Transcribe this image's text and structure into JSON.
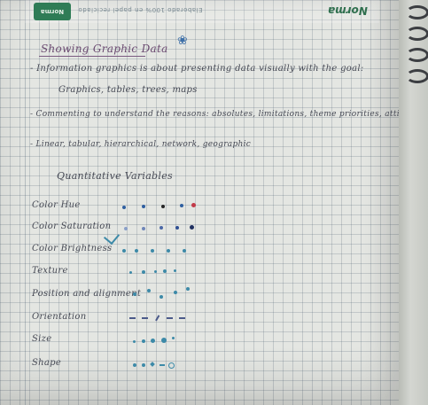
{
  "photo": {
    "subject": "spiral notebook page with handwritten notes",
    "paper": {
      "header": {
        "logo_text": "Norma",
        "printed_text": "Elaborado 100% en papel reciclado",
        "brand_text": "Norma"
      }
    },
    "notes": {
      "title": "Showing Graphic Data",
      "lines": [
        "- Information graphics is about presenting data visually with the goal:",
        "Graphics, tables, trees, maps",
        "- Commenting to understand the reasons: absolutes, limitations, theme priorities, attitudes",
        "- Linear, tabular, hierarchical, network, geographic"
      ],
      "variables_heading": "Quantitative Variables",
      "variables": [
        "Color Hue",
        "Color Saturation",
        "Color Brightness",
        "Texture",
        "Position and alignment",
        "Orientation",
        "Size",
        "Shape"
      ]
    },
    "ink_colors": {
      "title": "#6a4a70",
      "text": "#474a55",
      "doodle": "#3d6fa8",
      "dot_blue": "#2f5fa0",
      "dot_red": "#c23a48",
      "dot_black": "#262626",
      "dot_teal": "#3d8aa8"
    }
  }
}
